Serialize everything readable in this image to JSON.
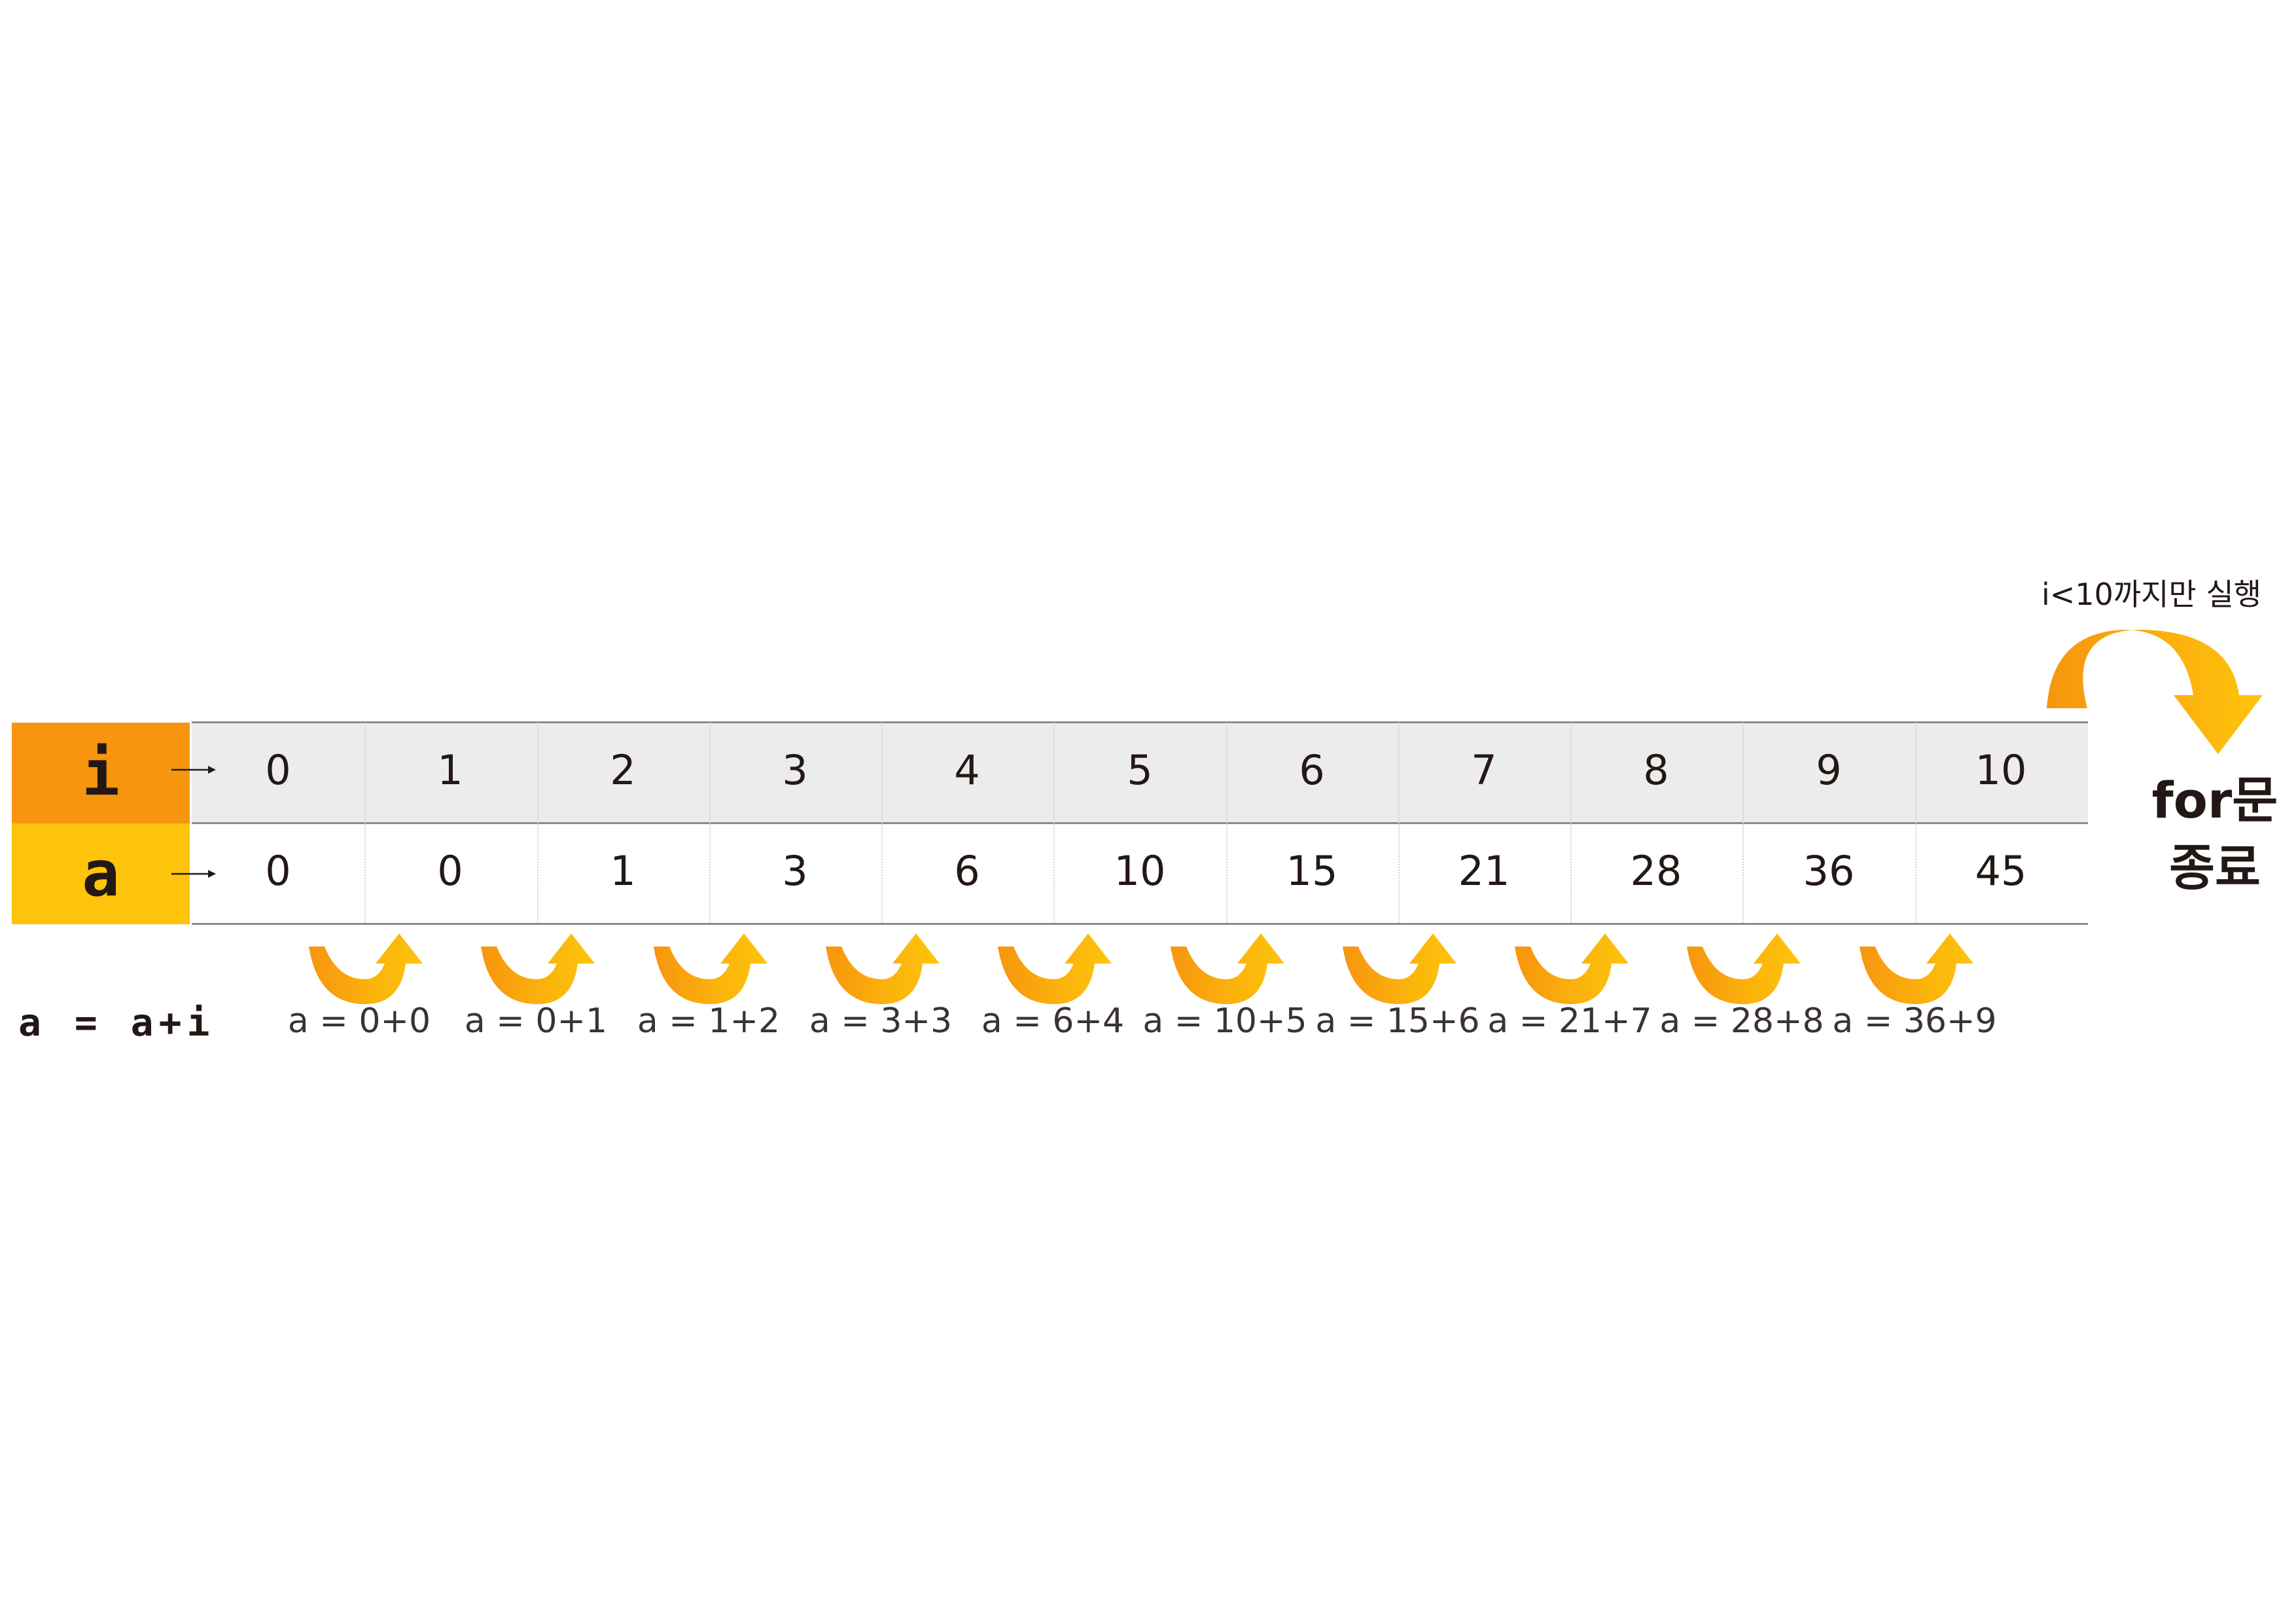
{
  "rows": {
    "i_label": "i",
    "a_label": "a",
    "i_values": [
      "0",
      "1",
      "2",
      "3",
      "4",
      "5",
      "6",
      "7",
      "8",
      "9",
      "10"
    ],
    "a_values": [
      "0",
      "0",
      "1",
      "3",
      "6",
      "10",
      "15",
      "21",
      "28",
      "36",
      "45"
    ]
  },
  "formula_label": "a = a+i",
  "formulas": [
    "a = 0+0",
    "a = 0+1",
    "a = 1+2",
    "a = 3+3",
    "a = 6+4",
    "a = 10+5",
    "a = 15+6",
    "a = 21+7",
    "a = 28+8",
    "a = 36+9"
  ],
  "loop_condition": "i<10까지만 실행",
  "end_label": {
    "line1": "for문",
    "line2": "종료"
  },
  "colors": {
    "i_row": "#f7950f",
    "a_row": "#fec40c",
    "i_row_bg": "#ececec",
    "arrow_orange": "#f7950f",
    "arrow_yellow": "#fec40c",
    "text": "#231815"
  },
  "icons": {
    "row_pointer": "small-right-arrow-icon",
    "step_arrow": "curved-up-arrow-icon",
    "exit_arrow": "curved-down-arrow-icon"
  }
}
